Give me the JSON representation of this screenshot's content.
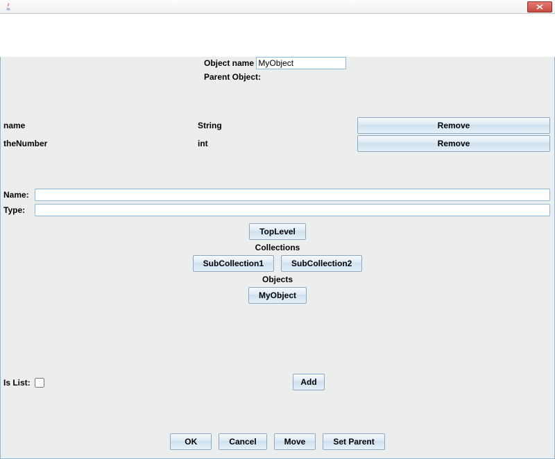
{
  "header": {
    "object_name_label": "Object name",
    "object_name_value": "MyObject",
    "parent_object_label": "Parent Object:"
  },
  "fields": [
    {
      "name": "name",
      "type": "String",
      "remove_label": "Remove"
    },
    {
      "name": "theNumber",
      "type": "int",
      "remove_label": "Remove"
    }
  ],
  "inputs": {
    "name_label": "Name:",
    "name_value": "",
    "type_label": "Type:",
    "type_value": ""
  },
  "buttons": {
    "toplevel": "TopLevel",
    "collections_label": "Collections",
    "subcollection1": "SubCollection1",
    "subcollection2": "SubCollection2",
    "objects_label": "Objects",
    "myobject": "MyObject",
    "add": "Add",
    "ok": "OK",
    "cancel": "Cancel",
    "move": "Move",
    "set_parent": "Set Parent"
  },
  "is_list_label": "Is List:"
}
